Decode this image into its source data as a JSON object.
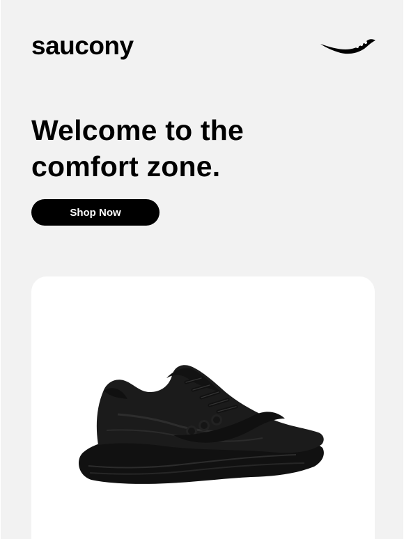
{
  "header": {
    "brand_name": "saucony",
    "brand_mark_icon": "saucony-swoosh-icon"
  },
  "hero": {
    "headline_line1": "Welcome to the",
    "headline_line2": "comfort zone.",
    "cta_label": "Shop Now"
  },
  "product": {
    "image_icon": "black-running-shoe",
    "card_color": "#ffffff"
  },
  "colors": {
    "background": "#f2f2f2",
    "text": "#000000",
    "button": "#000000",
    "button_text": "#ffffff"
  }
}
